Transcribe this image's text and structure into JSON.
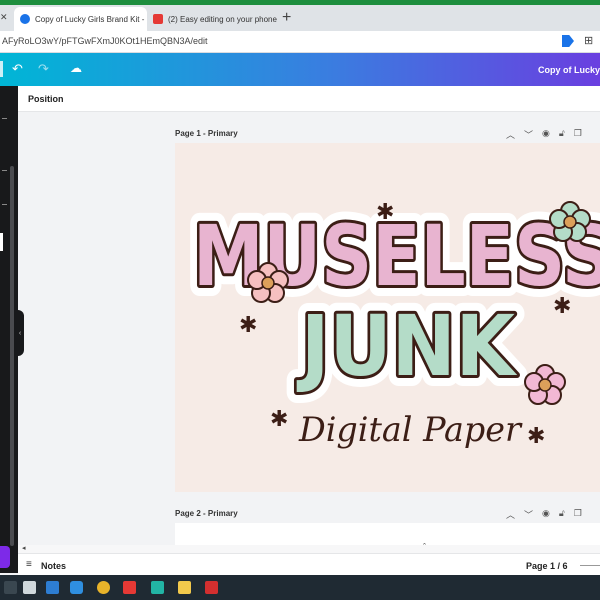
{
  "browser": {
    "tabs": [
      {
        "title": "Copy of Lucky Girls Brand Kit - 2",
        "active": true
      },
      {
        "title": "(2) Easy editing on your phone",
        "active": false
      }
    ],
    "url": "AFyRoLO3wY/pFTGwFXmJ0KOt1HEmQBN3A/edit"
  },
  "editor": {
    "doc_title": "Copy of Lucky",
    "panel_title": "Position",
    "pages": [
      {
        "label": "Page 1 - Primary"
      },
      {
        "label": "Page 2 - Primary"
      }
    ],
    "design": {
      "line1": "MUSELESS",
      "line2": "JUNK",
      "subtitle": "Digital Paper"
    },
    "footer": {
      "notes_label": "Notes",
      "page_indicator": "Page 1 / 6"
    }
  },
  "colors": {
    "brand_gradient_start": "#00b6d6",
    "brand_gradient_end": "#6a3fe0",
    "pink": "#e8b4d0",
    "mint": "#b4dcc8",
    "orange": "#dca05a",
    "outline": "#3c1e16"
  },
  "icons": [
    "undo-icon",
    "redo-icon",
    "cloud-saved-icon",
    "eye-icon",
    "lock-icon",
    "copy-icon",
    "notes-icon"
  ]
}
